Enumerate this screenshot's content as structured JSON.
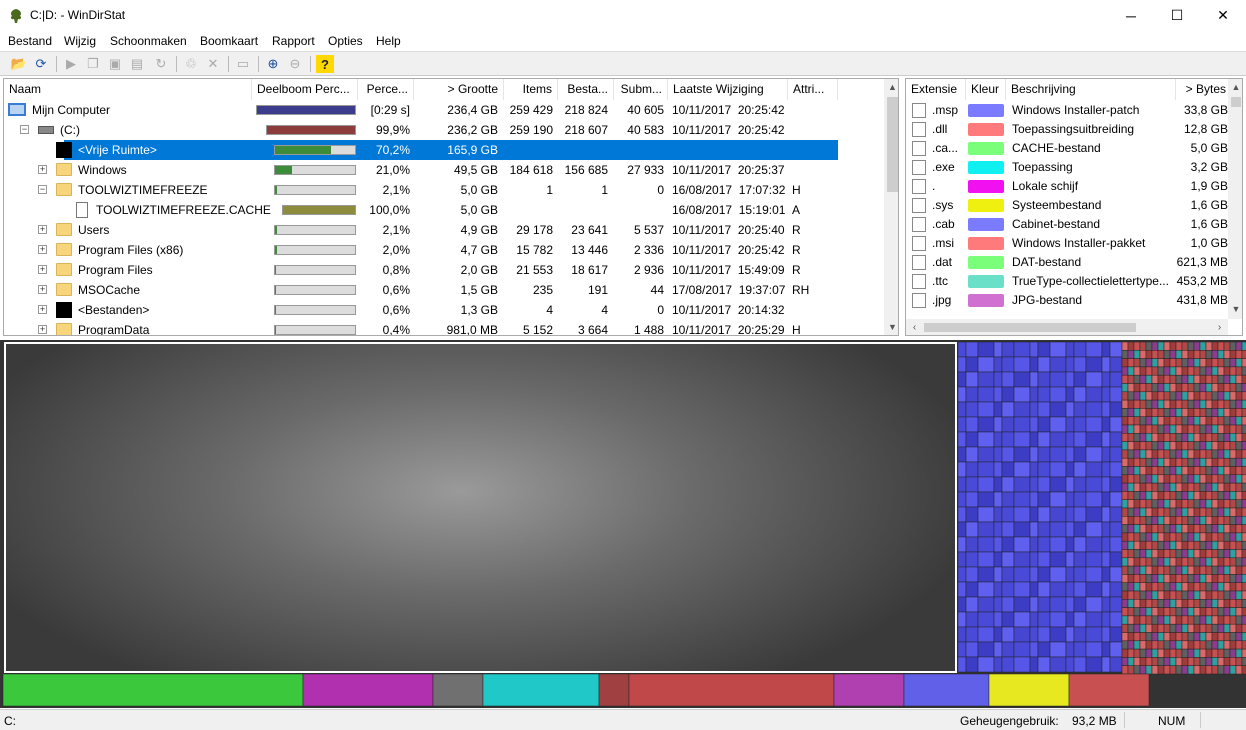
{
  "window": {
    "title": "C:|D: - WinDirStat",
    "minimize": "─",
    "maximize": "☐",
    "close": "✕"
  },
  "menu": [
    "Bestand",
    "Wijzig",
    "Schoonmaken",
    "Boomkaart",
    "Rapport",
    "Opties",
    "Help"
  ],
  "toolbar_icons": [
    "open-folder-icon",
    "refresh-icon",
    "play-icon",
    "copy-icon",
    "explorer-icon",
    "command-prompt-icon",
    "undo-icon",
    "recycle-icon",
    "delete-icon",
    "new-folder-icon",
    "zoom-in-icon",
    "zoom-out-icon",
    "help-icon"
  ],
  "tree": {
    "columns": [
      "Naam",
      "Deelboom Perc...",
      "Perce...",
      "> Grootte",
      "Items",
      "Besta...",
      "Subm...",
      "Laatste Wijziging",
      "Attri..."
    ],
    "rows": [
      {
        "name": "Mijn Computer",
        "bar_pct": 100,
        "bar_color": "#3c3c8c",
        "perc": "[0:29 s]",
        "size": "236,4 GB",
        "items": "259 429",
        "files": "218 824",
        "subdirs": "40 605",
        "date": "10/11/2017  20:25:42",
        "attr": ""
      },
      {
        "name": "(C:)",
        "bar_pct": 99.9,
        "bar_color": "#8c3c3c",
        "perc": "99,9%",
        "size": "236,2 GB",
        "items": "259 190",
        "files": "218 607",
        "subdirs": "40 583",
        "date": "10/11/2017  20:25:42",
        "attr": ""
      },
      {
        "name": "<Vrije Ruimte>",
        "bar_pct": 70.2,
        "bar_color": "#3c8c3c",
        "perc": "70,2%",
        "size": "165,9 GB",
        "items": "",
        "files": "",
        "subdirs": "",
        "date": "",
        "attr": ""
      },
      {
        "name": "Windows",
        "bar_pct": 21.0,
        "bar_color": "#3c8c3c",
        "perc": "21,0%",
        "size": "49,5 GB",
        "items": "184 618",
        "files": "156 685",
        "subdirs": "27 933",
        "date": "10/11/2017  20:25:37",
        "attr": ""
      },
      {
        "name": "TOOLWIZTIMEFREEZE",
        "bar_pct": 2.1,
        "bar_color": "#3c8c3c",
        "perc": "2,1%",
        "size": "5,0 GB",
        "items": "1",
        "files": "1",
        "subdirs": "0",
        "date": "16/08/2017  17:07:32",
        "attr": "H"
      },
      {
        "name": "TOOLWIZTIMEFREEZE.CACHE",
        "bar_pct": 100,
        "bar_color": "#8c8c3c",
        "perc": "100,0%",
        "size": "5,0 GB",
        "items": "",
        "files": "",
        "subdirs": "",
        "date": "16/08/2017  15:19:01",
        "attr": "A"
      },
      {
        "name": "Users",
        "bar_pct": 2.1,
        "bar_color": "#3c8c3c",
        "perc": "2,1%",
        "size": "4,9 GB",
        "items": "29 178",
        "files": "23 641",
        "subdirs": "5 537",
        "date": "10/11/2017  20:25:40",
        "attr": "R"
      },
      {
        "name": "Program Files (x86)",
        "bar_pct": 2.0,
        "bar_color": "#3c8c3c",
        "perc": "2,0%",
        "size": "4,7 GB",
        "items": "15 782",
        "files": "13 446",
        "subdirs": "2 336",
        "date": "10/11/2017  20:25:42",
        "attr": "R"
      },
      {
        "name": "Program Files",
        "bar_pct": 0.8,
        "bar_color": "#3c8c3c",
        "perc": "0,8%",
        "size": "2,0 GB",
        "items": "21 553",
        "files": "18 617",
        "subdirs": "2 936",
        "date": "10/11/2017  15:49:09",
        "attr": "R"
      },
      {
        "name": "MSOCache",
        "bar_pct": 0.6,
        "bar_color": "#3c8c3c",
        "perc": "0,6%",
        "size": "1,5 GB",
        "items": "235",
        "files": "191",
        "subdirs": "44",
        "date": "17/08/2017  19:37:07",
        "attr": "RH"
      },
      {
        "name": "<Bestanden>",
        "bar_pct": 0.6,
        "bar_color": "#3c8c3c",
        "perc": "0,6%",
        "size": "1,3 GB",
        "items": "4",
        "files": "4",
        "subdirs": "0",
        "date": "10/11/2017  20:14:32",
        "attr": ""
      },
      {
        "name": "ProgramData",
        "bar_pct": 0.4,
        "bar_color": "#3c8c3c",
        "perc": "0,4%",
        "size": "981,0 MB",
        "items": "5 152",
        "files": "3 664",
        "subdirs": "1 488",
        "date": "10/11/2017  20:25:29",
        "attr": "H"
      }
    ]
  },
  "extensions": {
    "columns": [
      "Extensie",
      "Kleur",
      "Beschrijving",
      "> Bytes"
    ],
    "rows": [
      {
        "ext": ".msp",
        "color": "#7b7bff",
        "desc": "Windows Installer-patch",
        "bytes": "33,8 GB"
      },
      {
        "ext": ".dll",
        "color": "#ff7b7b",
        "desc": "Toepassingsuitbreiding",
        "bytes": "12,8 GB"
      },
      {
        "ext": ".ca...",
        "color": "#7bff7b",
        "desc": "CACHE-bestand",
        "bytes": "5,0 GB"
      },
      {
        "ext": ".exe",
        "color": "#10f0f0",
        "desc": "Toepassing",
        "bytes": "3,2 GB"
      },
      {
        "ext": ".",
        "color": "#f010f0",
        "desc": "Lokale schijf",
        "bytes": "1,9 GB"
      },
      {
        "ext": ".sys",
        "color": "#f0f010",
        "desc": "Systeembestand",
        "bytes": "1,6 GB"
      },
      {
        "ext": ".cab",
        "color": "#7b7bff",
        "desc": "Cabinet-bestand",
        "bytes": "1,6 GB"
      },
      {
        "ext": ".msi",
        "color": "#ff7b7b",
        "desc": "Windows Installer-pakket",
        "bytes": "1,0 GB"
      },
      {
        "ext": ".dat",
        "color": "#7bff7b",
        "desc": "DAT-bestand",
        "bytes": "621,3 MB"
      },
      {
        "ext": ".ttc",
        "color": "#6be0c8",
        "desc": "TrueType-collectielettertype...",
        "bytes": "453,2 MB"
      },
      {
        "ext": ".jpg",
        "color": "#d070d0",
        "desc": "JPG-bestand",
        "bytes": "431,8 MB"
      }
    ]
  },
  "status": {
    "path": "C:",
    "memory_label": "Geheugengebruik:",
    "memory_value": "93,2 MB",
    "num": "NUM"
  }
}
